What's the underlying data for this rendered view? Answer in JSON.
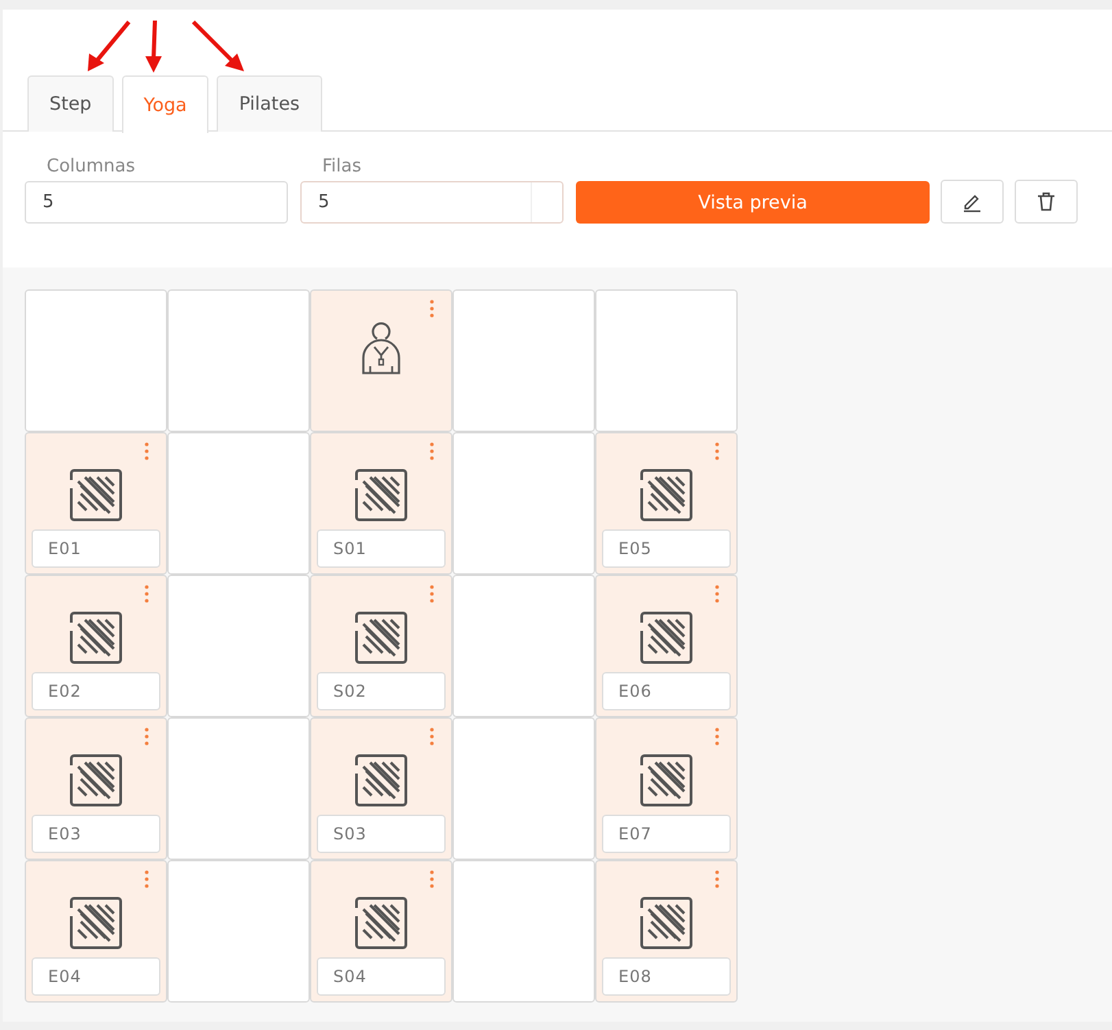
{
  "tabs": [
    {
      "label": "Step",
      "selected": false
    },
    {
      "label": "Yoga",
      "selected": true
    },
    {
      "label": "Pilates",
      "selected": false
    }
  ],
  "fields": [
    {
      "label": "Columnas",
      "value": "5",
      "kind": "plain"
    },
    {
      "label": "Filas",
      "value": "5",
      "kind": "spinner"
    }
  ],
  "preview_button": "Vista previa",
  "grid": [
    [
      {
        "kind": "empty"
      },
      {
        "kind": "empty"
      },
      {
        "kind": "instructor"
      },
      {
        "kind": "empty"
      },
      {
        "kind": "empty"
      }
    ],
    [
      {
        "kind": "station",
        "label": "E01"
      },
      {
        "kind": "empty"
      },
      {
        "kind": "station",
        "label": "S01"
      },
      {
        "kind": "empty"
      },
      {
        "kind": "station",
        "label": "E05"
      }
    ],
    [
      {
        "kind": "station",
        "label": "E02"
      },
      {
        "kind": "empty"
      },
      {
        "kind": "station",
        "label": "S02"
      },
      {
        "kind": "empty"
      },
      {
        "kind": "station",
        "label": "E06"
      }
    ],
    [
      {
        "kind": "station",
        "label": "E03"
      },
      {
        "kind": "empty"
      },
      {
        "kind": "station",
        "label": "S03"
      },
      {
        "kind": "empty"
      },
      {
        "kind": "station",
        "label": "E07"
      }
    ],
    [
      {
        "kind": "station",
        "label": "E04"
      },
      {
        "kind": "empty"
      },
      {
        "kind": "station",
        "label": "S04"
      },
      {
        "kind": "empty"
      },
      {
        "kind": "station",
        "label": "E08"
      }
    ]
  ]
}
